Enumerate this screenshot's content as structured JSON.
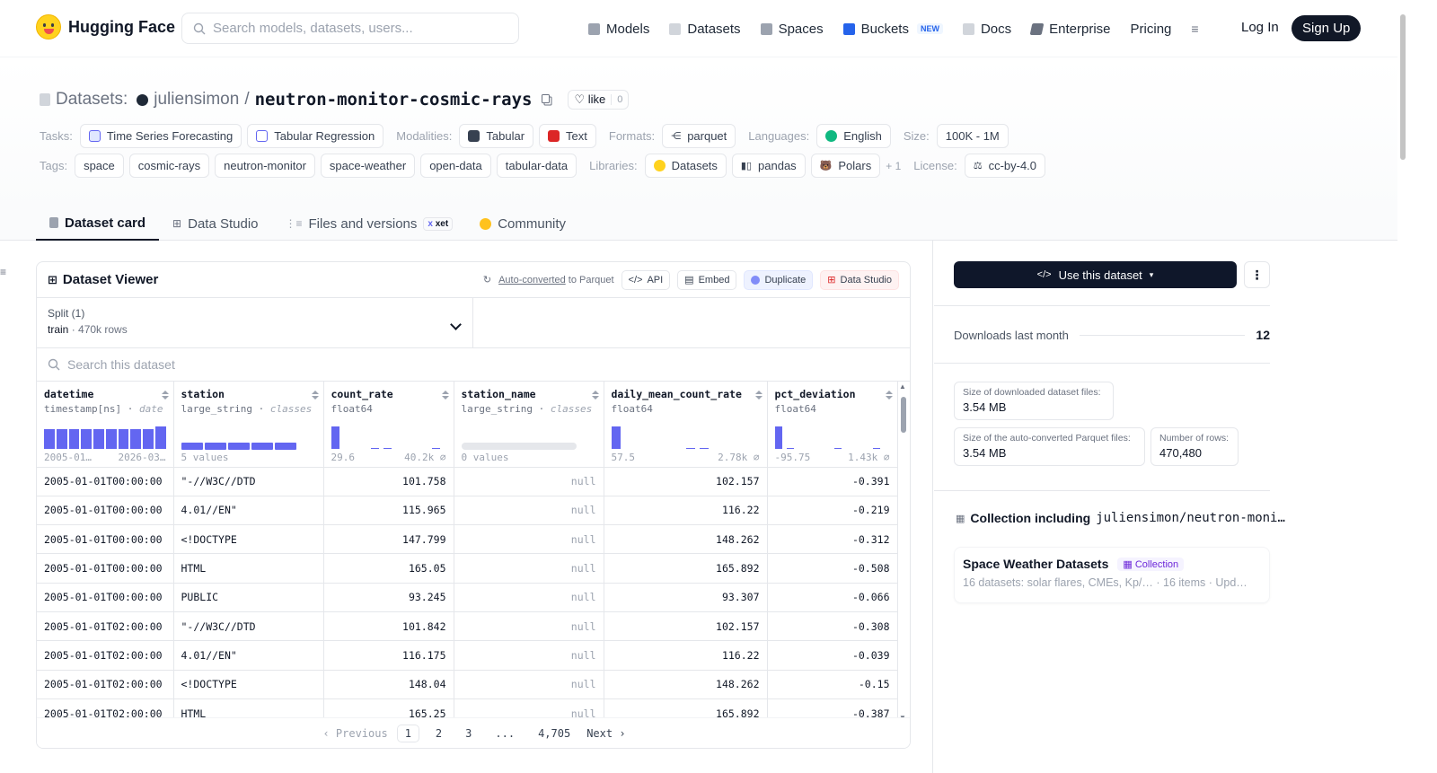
{
  "nav": {
    "brand": "Hugging Face",
    "search_placeholder": "Search models, datasets, users...",
    "links": [
      "Models",
      "Datasets",
      "Spaces",
      "Buckets",
      "Docs",
      "Enterprise",
      "Pricing"
    ],
    "new_badge": "NEW",
    "login": "Log In",
    "signup": "Sign Up"
  },
  "repo": {
    "label": "Datasets:",
    "user": "juliensimon",
    "sep": "/",
    "name": "neutron-monitor-cosmic-rays",
    "like": "like",
    "likes": "0"
  },
  "meta": {
    "tasks_label": "Tasks:",
    "tasks": [
      "Time Series Forecasting",
      "Tabular Regression"
    ],
    "modalities_label": "Modalities:",
    "modalities": [
      "Tabular",
      "Text"
    ],
    "formats_label": "Formats:",
    "formats": [
      "parquet"
    ],
    "languages_label": "Languages:",
    "languages": [
      "English"
    ],
    "size_label": "Size:",
    "size": "100K - 1M",
    "tags_label": "Tags:",
    "tags": [
      "space",
      "cosmic-rays",
      "neutron-monitor",
      "space-weather",
      "open-data",
      "tabular-data"
    ],
    "libraries_label": "Libraries:",
    "libraries": [
      "Datasets",
      "pandas",
      "Polars"
    ],
    "libraries_more": "+ 1",
    "license_label": "License:",
    "license": "cc-by-4.0"
  },
  "tabs": [
    "Dataset card",
    "Data Studio",
    "Files and versions",
    "Community"
  ],
  "tab_xet": "xet",
  "viewer": {
    "title": "Dataset Viewer",
    "auto_converted": "Auto-converted",
    "to_parquet": "to Parquet",
    "api": "API",
    "embed": "Embed",
    "duplicate": "Duplicate",
    "data_studio": "Data Studio",
    "split_label": "Split (1)",
    "split_name": "train",
    "split_rows": "470k rows",
    "search_placeholder": "Search this dataset",
    "columns": [
      {
        "name": "datetime",
        "type": "timestamp[ns]",
        "kind": "date",
        "min": "2005-01…",
        "max": "2026-03…"
      },
      {
        "name": "station",
        "type": "large_string",
        "kind": "classes",
        "min": "5 values",
        "max": ""
      },
      {
        "name": "count_rate",
        "type": "float64",
        "kind": "",
        "min": "29.6",
        "max": "40.2k"
      },
      {
        "name": "station_name",
        "type": "large_string",
        "kind": "classes",
        "min": "0 values",
        "max": ""
      },
      {
        "name": "daily_mean_count_rate",
        "type": "float64",
        "kind": "",
        "min": "57.5",
        "max": "2.78k"
      },
      {
        "name": "pct_deviation",
        "type": "float64",
        "kind": "",
        "min": "-95.75",
        "max": "1.43k"
      }
    ],
    "rows": [
      [
        "2005-01-01T00:00:00",
        "\"-//W3C//DTD",
        "101.758",
        "null",
        "102.157",
        "-0.391"
      ],
      [
        "2005-01-01T00:00:00",
        "4.01//EN\"",
        "115.965",
        "null",
        "116.22",
        "-0.219"
      ],
      [
        "2005-01-01T00:00:00",
        "<!DOCTYPE",
        "147.799",
        "null",
        "148.262",
        "-0.312"
      ],
      [
        "2005-01-01T00:00:00",
        "HTML",
        "165.05",
        "null",
        "165.892",
        "-0.508"
      ],
      [
        "2005-01-01T00:00:00",
        "PUBLIC",
        "93.245",
        "null",
        "93.307",
        "-0.066"
      ],
      [
        "2005-01-01T02:00:00",
        "\"-//W3C//DTD",
        "101.842",
        "null",
        "102.157",
        "-0.308"
      ],
      [
        "2005-01-01T02:00:00",
        "4.01//EN\"",
        "116.175",
        "null",
        "116.22",
        "-0.039"
      ],
      [
        "2005-01-01T02:00:00",
        "<!DOCTYPE",
        "148.04",
        "null",
        "148.262",
        "-0.15"
      ],
      [
        "2005-01-01T02:00:00",
        "HTML",
        "165.25",
        "null",
        "165.892",
        "-0.387"
      ]
    ],
    "pager": {
      "prev": "Previous",
      "pages": [
        "1",
        "2",
        "3",
        "...",
        "4,705"
      ],
      "next": "Next"
    }
  },
  "sidebar": {
    "use_dataset": "Use this dataset",
    "downloads_label": "Downloads last month",
    "downloads": "12",
    "dl_size_label": "Size of downloaded dataset files:",
    "dl_size": "3.54 MB",
    "pq_size_label": "Size of the auto-converted Parquet files:",
    "pq_size": "3.54 MB",
    "rows_label": "Number of rows:",
    "rows": "470,480",
    "collection_label": "Collection including",
    "collection_repo": "juliensimon/neutron-moni…",
    "collection_name": "Space Weather Datasets",
    "collection_badge": "Collection",
    "collection_desc": "16 datasets: solar flares, CMEs, Kp/…",
    "collection_items": "16 items",
    "collection_updated": "Upd…"
  }
}
